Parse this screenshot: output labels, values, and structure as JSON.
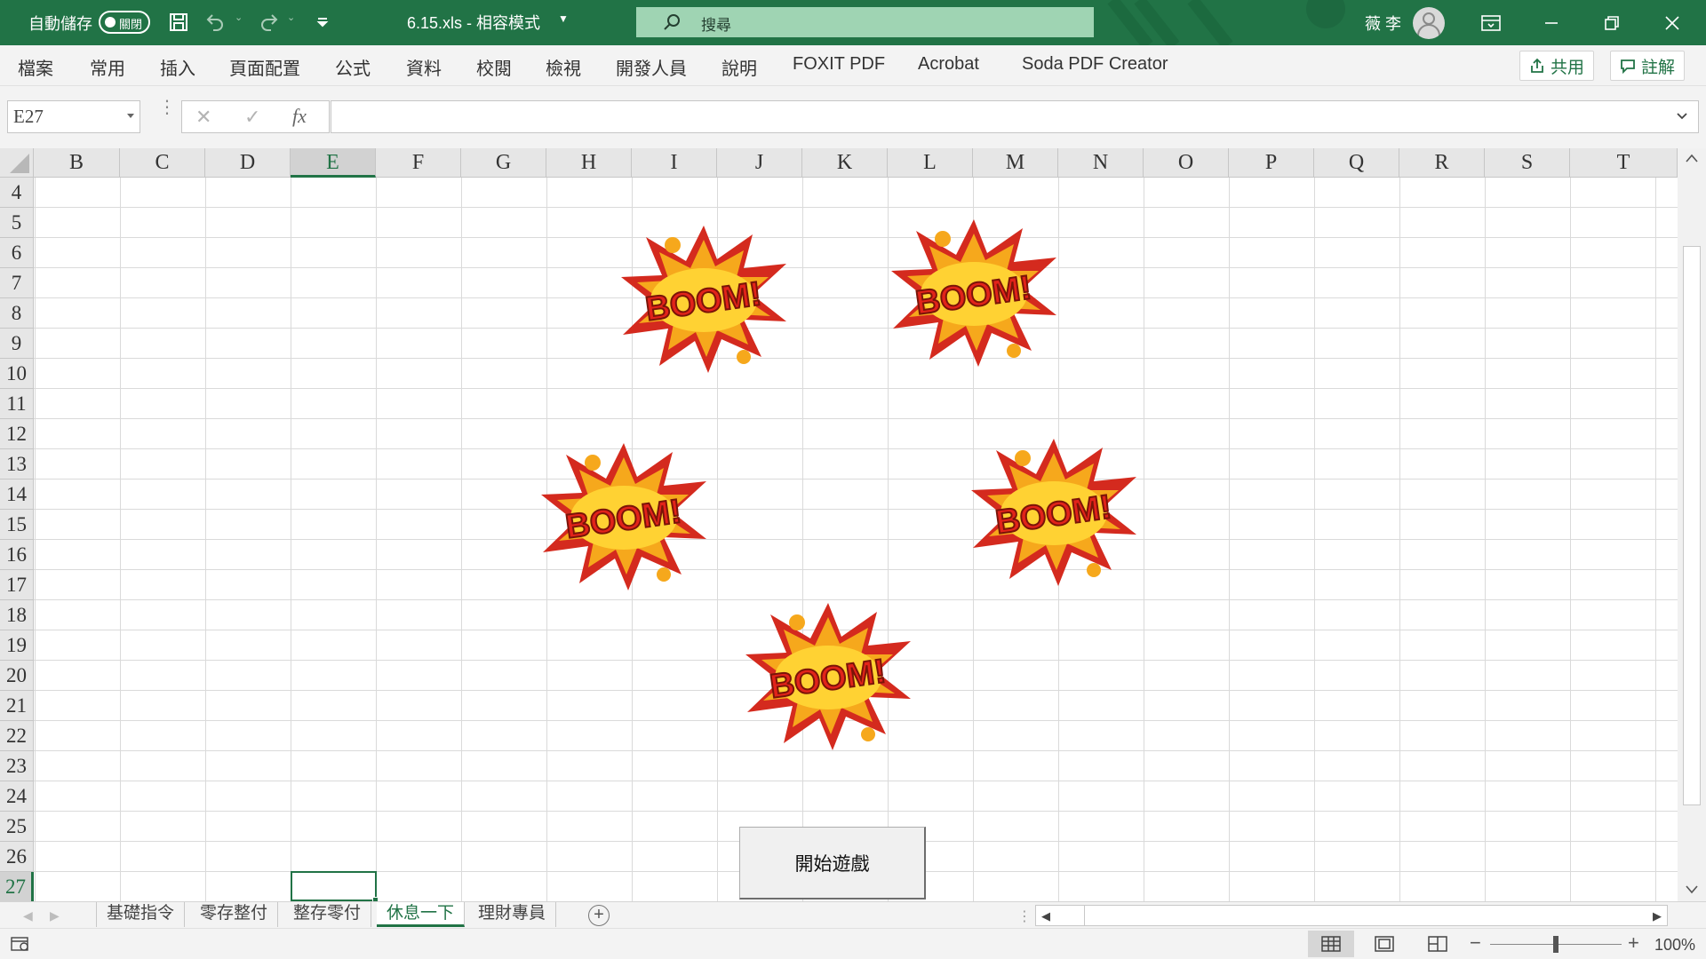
{
  "titlebar": {
    "autosave_label": "自動儲存",
    "autosave_state": "關閉",
    "filename": "6.15.xls  -  相容模式",
    "search_placeholder": "搜尋",
    "user_name": "薇 李",
    "accent_color": "#217346"
  },
  "ribbon": {
    "tabs": [
      "檔案",
      "常用",
      "插入",
      "頁面配置",
      "公式",
      "資料",
      "校閱",
      "檢視",
      "開發人員",
      "說明",
      "FOXIT PDF",
      "Acrobat",
      "Soda PDF Creator"
    ],
    "share_label": "共用",
    "comments_label": "註解"
  },
  "formula_bar": {
    "name_box": "E27",
    "fx": "fx",
    "formula": ""
  },
  "grid": {
    "columns": [
      "B",
      "C",
      "D",
      "E",
      "F",
      "G",
      "H",
      "I",
      "J",
      "K",
      "L",
      "M",
      "N",
      "O",
      "P",
      "Q",
      "R",
      "S",
      "T"
    ],
    "rows": [
      "4",
      "5",
      "6",
      "7",
      "8",
      "9",
      "10",
      "11",
      "12",
      "13",
      "14",
      "15",
      "16",
      "17",
      "18",
      "19",
      "20",
      "21",
      "22",
      "23",
      "24",
      "25",
      "26",
      "27"
    ],
    "selected_column": "E",
    "selected_row": "27",
    "boom_images": 5,
    "start_button_label": "開始遊戲"
  },
  "sheets": {
    "tabs": [
      "基礎指令",
      "零存整付",
      "整存零付",
      "休息一下",
      "理財專員"
    ],
    "active": "休息一下"
  },
  "statusbar": {
    "zoom": "100%",
    "zoom_minus": "−",
    "zoom_plus": "+"
  }
}
